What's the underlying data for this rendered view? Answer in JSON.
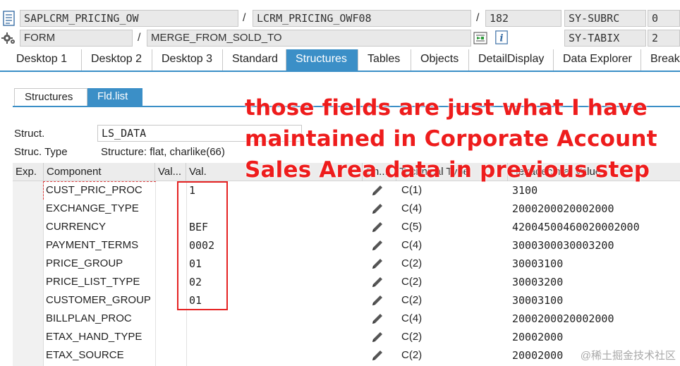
{
  "header": {
    "program": "SAPLCRM_PRICING_OW",
    "include": "LCRM_PRICING_OWF08",
    "line": "182",
    "subrc_label": "SY-SUBRC",
    "subrc_value": "0",
    "event_type": "FORM",
    "event_name": "MERGE_FROM_SOLD_TO",
    "tabix_label": "SY-TABIX",
    "tabix_value": "2",
    "separator": "/"
  },
  "tabs": [
    "Desktop 1",
    "Desktop 2",
    "Desktop 3",
    "Standard",
    "Structures",
    "Tables",
    "Objects",
    "DetailDisplay",
    "Data Explorer",
    "Break."
  ],
  "active_tab": "Structures",
  "subtabs": [
    "Structures",
    "Fld.list"
  ],
  "active_subtab": "Fld.list",
  "struct": {
    "struct_label": "Struct.",
    "struct_value": "LS_DATA",
    "type_label": "Struc. Type",
    "type_value": "Structure: flat, charlike(66)"
  },
  "grid": {
    "columns": [
      "Exp.",
      "Component",
      "Val...",
      "Val.",
      "Ch...",
      "Technical Type",
      "Hexadecimal Value"
    ],
    "rows": [
      {
        "component": "CUST_PRIC_PROC",
        "value": "1",
        "type": "C(1)",
        "hex": "3100"
      },
      {
        "component": "EXCHANGE_TYPE",
        "value": "",
        "type": "C(4)",
        "hex": "2000200020002000"
      },
      {
        "component": "CURRENCY",
        "value": "BEF",
        "type": "C(5)",
        "hex": "42004500460020002000"
      },
      {
        "component": "PAYMENT_TERMS",
        "value": "0002",
        "type": "C(4)",
        "hex": "3000300030003200"
      },
      {
        "component": "PRICE_GROUP",
        "value": "01",
        "type": "C(2)",
        "hex": "30003100"
      },
      {
        "component": "PRICE_LIST_TYPE",
        "value": "02",
        "type": "C(2)",
        "hex": "30003200"
      },
      {
        "component": "CUSTOMER_GROUP",
        "value": "01",
        "type": "C(2)",
        "hex": "30003100"
      },
      {
        "component": "BILLPLAN_PROC",
        "value": "",
        "type": "C(4)",
        "hex": "2000200020002000"
      },
      {
        "component": "ETAX_HAND_TYPE",
        "value": "",
        "type": "C(2)",
        "hex": "20002000"
      },
      {
        "component": "ETAX_SOURCE",
        "value": "",
        "type": "C(2)",
        "hex": "20002000"
      }
    ]
  },
  "annotation": {
    "lines": [
      "those fields are just what I have",
      "maintained in Corporate Account",
      "Sales Area data in previous step"
    ],
    "color": "#ee1c1c"
  },
  "watermark": "@稀土掘金技术社区",
  "colors": {
    "accent": "#3b8fc7",
    "highlight_box": "#e52222"
  },
  "icons": {
    "program": "document-icon",
    "event": "gear-icon",
    "step": "step-icon",
    "info": "info-icon",
    "edit": "pencil-icon"
  }
}
